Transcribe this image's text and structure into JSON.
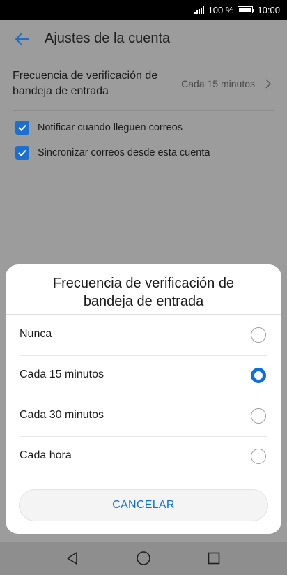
{
  "status_bar": {
    "battery": "100 %",
    "time": "10:00",
    "battery_level": 1.0
  },
  "header": {
    "title": "Ajustes de la cuenta"
  },
  "settings": {
    "frequency_label": "Frecuencia de verificación de bandeja de entrada",
    "frequency_value": "Cada 15 minutos",
    "notify_label": "Notificar cuando lleguen correos",
    "sync_label": "Sincronizar correos desde esta cuenta"
  },
  "dialog": {
    "title": "Frecuencia de verificación de bandeja de entrada",
    "options": [
      {
        "label": "Nunca",
        "selected": false
      },
      {
        "label": "Cada 15 minutos",
        "selected": true
      },
      {
        "label": "Cada 30 minutos",
        "selected": false
      },
      {
        "label": "Cada hora",
        "selected": false
      }
    ],
    "cancel_label": "CANCELAR"
  },
  "colors": {
    "accent": "#0a6fe0",
    "checkbox": "#1b6fd1"
  }
}
